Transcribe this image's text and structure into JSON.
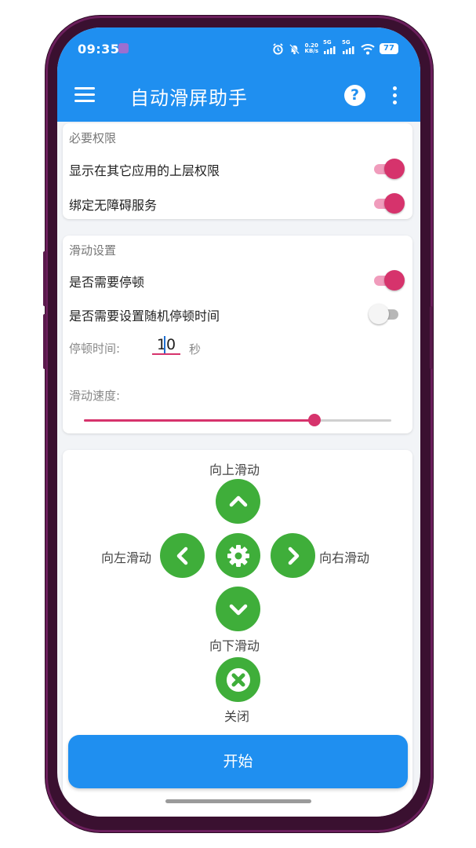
{
  "status_bar": {
    "time": "09:35",
    "net_speed_value": "0.20",
    "net_speed_unit": "KB/s",
    "sim1_label": "5G",
    "sim2_label": "5G",
    "battery": "77",
    "icons": [
      "alarm-icon",
      "mute-icon",
      "signal-icon",
      "wifi-icon",
      "battery-icon"
    ]
  },
  "app_bar": {
    "title": "自动滑屏助手",
    "menu_icon": "hamburger-icon",
    "help_icon": "question-icon",
    "help_glyph": "?",
    "more_icon": "vertical-dots-icon"
  },
  "permissions": {
    "title": "必要权限",
    "items": [
      {
        "label": "显示在其它应用的上层权限",
        "enabled": true
      },
      {
        "label": "绑定无障碍服务",
        "enabled": true
      }
    ]
  },
  "slide_settings": {
    "title": "滑动设置",
    "pause_toggle": {
      "label": "是否需要停顿",
      "enabled": true
    },
    "random_pause_toggle": {
      "label": "是否需要设置随机停顿时间",
      "enabled": false
    },
    "pause_time": {
      "label": "停顿时间:",
      "value": "10",
      "unit": "秒"
    },
    "speed": {
      "label": "滑动速度:",
      "value_fraction": 0.75
    }
  },
  "controls": {
    "up_label": "向上滑动",
    "down_label": "向下滑动",
    "left_label": "向左滑动",
    "right_label": "向右滑动",
    "close_label": "关闭",
    "settings_icon": "gear-icon"
  },
  "start_button": {
    "label": "开始"
  },
  "colors": {
    "primary": "#1f8ff0",
    "accent": "#d6336c",
    "green": "#3fae3a",
    "background": "#f2f4f7"
  }
}
